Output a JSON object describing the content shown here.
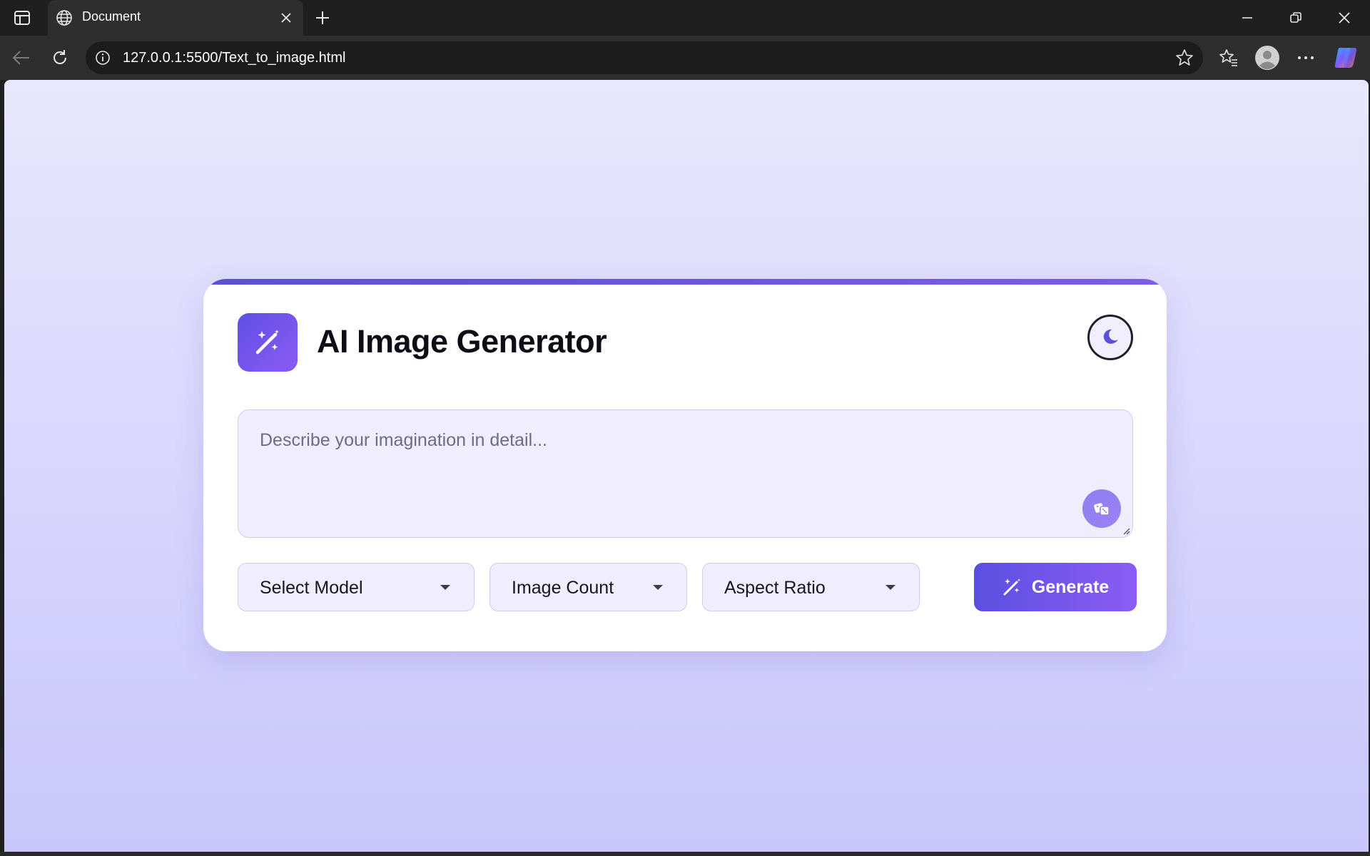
{
  "browser": {
    "tab_title": "Document",
    "url": "127.0.0.1:5500/Text_to_image.html",
    "icons": {
      "sidebar": "tab-sidebar-icon",
      "favicon": "globe-icon",
      "close": "close-icon",
      "new_tab": "plus-icon",
      "back": "back-arrow-icon",
      "reload": "reload-icon",
      "info": "info-icon",
      "favorite": "star-icon",
      "favorites": "favorites-icon",
      "profile": "profile-icon",
      "more": "more-icon",
      "copilot": "copilot-icon"
    }
  },
  "app": {
    "title": "AI Image Generator",
    "logo_icon": "magic-wand-icon",
    "theme_icon": "moon-icon",
    "prompt": {
      "placeholder": "Describe your imagination in detail...",
      "value": "",
      "random_icon": "dice-icon"
    },
    "controls": {
      "model_label": "Select Model",
      "count_label": "Image Count",
      "ratio_label": "Aspect Ratio"
    },
    "generate": {
      "label": "Generate",
      "icon": "magic-wand-icon"
    }
  },
  "colors": {
    "accent": "#5b4fe0",
    "accent_end": "#8b5cf6",
    "background_top": "#e7e7fd",
    "background_bottom": "#c9c6fb",
    "field_bg": "#f0eefd"
  }
}
